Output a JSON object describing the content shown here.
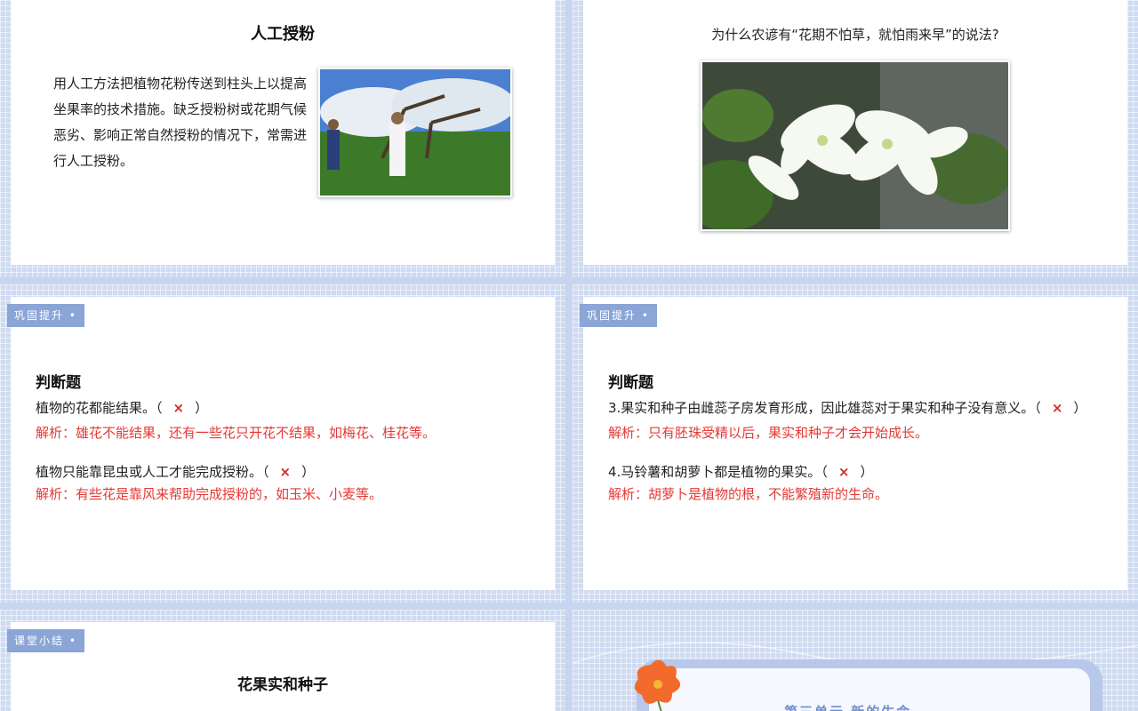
{
  "slide1": {
    "title": "人工授粉",
    "paragraph": "用人工方法把植物花粉传送到柱头上以提高坐果率的技术措施。缺乏授粉树或花期气候恶劣、影响正常自然授粉的情况下，常需进行人工授粉。"
  },
  "slide2": {
    "question": "为什么农谚有“花期不怕草，就怕雨来早”的说法?"
  },
  "slide3": {
    "tag": "巩固提升 •",
    "heading": "判断题",
    "q1": "植物的花都能结果。（",
    "q1_close": "）",
    "a1": "解析：雄花不能结果，还有一些花只开花不结果，如梅花、桂花等。",
    "q2": "植物只能靠昆虫或人工才能完成授粉。（",
    "q2_close": "）",
    "a2": "解析：有些花是靠风来帮助完成授粉的，如玉米、小麦等。"
  },
  "slide4": {
    "tag": "巩固提升 •",
    "heading": "判断题",
    "q3": "3.果实和种子由雌蕊子房发育形成，因此雄蕊对于果实和种子没有意义。（",
    "q3_close": "）",
    "a3": "解析：只有胚珠受精以后，果实和种子才会开始成长。",
    "q4": "4.马铃薯和胡萝卜都是植物的果实。（",
    "q4_close": "）",
    "a4": "解析：胡萝卜是植物的根，不能繁殖新的生命。"
  },
  "slide5": {
    "tag": "课堂小结 •",
    "title": "花果实和种子"
  },
  "slide6": {
    "unit_title": "第三单元 新的生命"
  },
  "mark": "×",
  "colors": {
    "accent": "#8aa5d6",
    "answer": "#e53935",
    "mark": "#d62828"
  }
}
